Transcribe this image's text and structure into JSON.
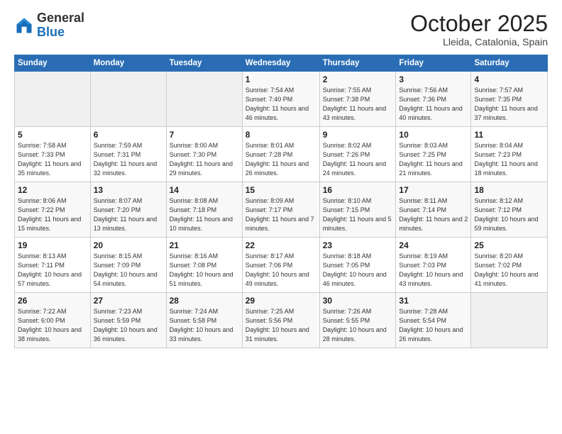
{
  "logo": {
    "general": "General",
    "blue": "Blue"
  },
  "header": {
    "month": "October 2025",
    "location": "Lleida, Catalonia, Spain"
  },
  "weekdays": [
    "Sunday",
    "Monday",
    "Tuesday",
    "Wednesday",
    "Thursday",
    "Friday",
    "Saturday"
  ],
  "weeks": [
    [
      {
        "day": "",
        "sunrise": "",
        "sunset": "",
        "daylight": ""
      },
      {
        "day": "",
        "sunrise": "",
        "sunset": "",
        "daylight": ""
      },
      {
        "day": "",
        "sunrise": "",
        "sunset": "",
        "daylight": ""
      },
      {
        "day": "1",
        "sunrise": "Sunrise: 7:54 AM",
        "sunset": "Sunset: 7:40 PM",
        "daylight": "Daylight: 11 hours and 46 minutes."
      },
      {
        "day": "2",
        "sunrise": "Sunrise: 7:55 AM",
        "sunset": "Sunset: 7:38 PM",
        "daylight": "Daylight: 11 hours and 43 minutes."
      },
      {
        "day": "3",
        "sunrise": "Sunrise: 7:56 AM",
        "sunset": "Sunset: 7:36 PM",
        "daylight": "Daylight: 11 hours and 40 minutes."
      },
      {
        "day": "4",
        "sunrise": "Sunrise: 7:57 AM",
        "sunset": "Sunset: 7:35 PM",
        "daylight": "Daylight: 11 hours and 37 minutes."
      }
    ],
    [
      {
        "day": "5",
        "sunrise": "Sunrise: 7:58 AM",
        "sunset": "Sunset: 7:33 PM",
        "daylight": "Daylight: 11 hours and 35 minutes."
      },
      {
        "day": "6",
        "sunrise": "Sunrise: 7:59 AM",
        "sunset": "Sunset: 7:31 PM",
        "daylight": "Daylight: 11 hours and 32 minutes."
      },
      {
        "day": "7",
        "sunrise": "Sunrise: 8:00 AM",
        "sunset": "Sunset: 7:30 PM",
        "daylight": "Daylight: 11 hours and 29 minutes."
      },
      {
        "day": "8",
        "sunrise": "Sunrise: 8:01 AM",
        "sunset": "Sunset: 7:28 PM",
        "daylight": "Daylight: 11 hours and 26 minutes."
      },
      {
        "day": "9",
        "sunrise": "Sunrise: 8:02 AM",
        "sunset": "Sunset: 7:26 PM",
        "daylight": "Daylight: 11 hours and 24 minutes."
      },
      {
        "day": "10",
        "sunrise": "Sunrise: 8:03 AM",
        "sunset": "Sunset: 7:25 PM",
        "daylight": "Daylight: 11 hours and 21 minutes."
      },
      {
        "day": "11",
        "sunrise": "Sunrise: 8:04 AM",
        "sunset": "Sunset: 7:23 PM",
        "daylight": "Daylight: 11 hours and 18 minutes."
      }
    ],
    [
      {
        "day": "12",
        "sunrise": "Sunrise: 8:06 AM",
        "sunset": "Sunset: 7:22 PM",
        "daylight": "Daylight: 11 hours and 15 minutes."
      },
      {
        "day": "13",
        "sunrise": "Sunrise: 8:07 AM",
        "sunset": "Sunset: 7:20 PM",
        "daylight": "Daylight: 11 hours and 13 minutes."
      },
      {
        "day": "14",
        "sunrise": "Sunrise: 8:08 AM",
        "sunset": "Sunset: 7:18 PM",
        "daylight": "Daylight: 11 hours and 10 minutes."
      },
      {
        "day": "15",
        "sunrise": "Sunrise: 8:09 AM",
        "sunset": "Sunset: 7:17 PM",
        "daylight": "Daylight: 11 hours and 7 minutes."
      },
      {
        "day": "16",
        "sunrise": "Sunrise: 8:10 AM",
        "sunset": "Sunset: 7:15 PM",
        "daylight": "Daylight: 11 hours and 5 minutes."
      },
      {
        "day": "17",
        "sunrise": "Sunrise: 8:11 AM",
        "sunset": "Sunset: 7:14 PM",
        "daylight": "Daylight: 11 hours and 2 minutes."
      },
      {
        "day": "18",
        "sunrise": "Sunrise: 8:12 AM",
        "sunset": "Sunset: 7:12 PM",
        "daylight": "Daylight: 10 hours and 59 minutes."
      }
    ],
    [
      {
        "day": "19",
        "sunrise": "Sunrise: 8:13 AM",
        "sunset": "Sunset: 7:11 PM",
        "daylight": "Daylight: 10 hours and 57 minutes."
      },
      {
        "day": "20",
        "sunrise": "Sunrise: 8:15 AM",
        "sunset": "Sunset: 7:09 PM",
        "daylight": "Daylight: 10 hours and 54 minutes."
      },
      {
        "day": "21",
        "sunrise": "Sunrise: 8:16 AM",
        "sunset": "Sunset: 7:08 PM",
        "daylight": "Daylight: 10 hours and 51 minutes."
      },
      {
        "day": "22",
        "sunrise": "Sunrise: 8:17 AM",
        "sunset": "Sunset: 7:06 PM",
        "daylight": "Daylight: 10 hours and 49 minutes."
      },
      {
        "day": "23",
        "sunrise": "Sunrise: 8:18 AM",
        "sunset": "Sunset: 7:05 PM",
        "daylight": "Daylight: 10 hours and 46 minutes."
      },
      {
        "day": "24",
        "sunrise": "Sunrise: 8:19 AM",
        "sunset": "Sunset: 7:03 PM",
        "daylight": "Daylight: 10 hours and 43 minutes."
      },
      {
        "day": "25",
        "sunrise": "Sunrise: 8:20 AM",
        "sunset": "Sunset: 7:02 PM",
        "daylight": "Daylight: 10 hours and 41 minutes."
      }
    ],
    [
      {
        "day": "26",
        "sunrise": "Sunrise: 7:22 AM",
        "sunset": "Sunset: 6:00 PM",
        "daylight": "Daylight: 10 hours and 38 minutes."
      },
      {
        "day": "27",
        "sunrise": "Sunrise: 7:23 AM",
        "sunset": "Sunset: 5:59 PM",
        "daylight": "Daylight: 10 hours and 36 minutes."
      },
      {
        "day": "28",
        "sunrise": "Sunrise: 7:24 AM",
        "sunset": "Sunset: 5:58 PM",
        "daylight": "Daylight: 10 hours and 33 minutes."
      },
      {
        "day": "29",
        "sunrise": "Sunrise: 7:25 AM",
        "sunset": "Sunset: 5:56 PM",
        "daylight": "Daylight: 10 hours and 31 minutes."
      },
      {
        "day": "30",
        "sunrise": "Sunrise: 7:26 AM",
        "sunset": "Sunset: 5:55 PM",
        "daylight": "Daylight: 10 hours and 28 minutes."
      },
      {
        "day": "31",
        "sunrise": "Sunrise: 7:28 AM",
        "sunset": "Sunset: 5:54 PM",
        "daylight": "Daylight: 10 hours and 26 minutes."
      },
      {
        "day": "",
        "sunrise": "",
        "sunset": "",
        "daylight": ""
      }
    ]
  ]
}
